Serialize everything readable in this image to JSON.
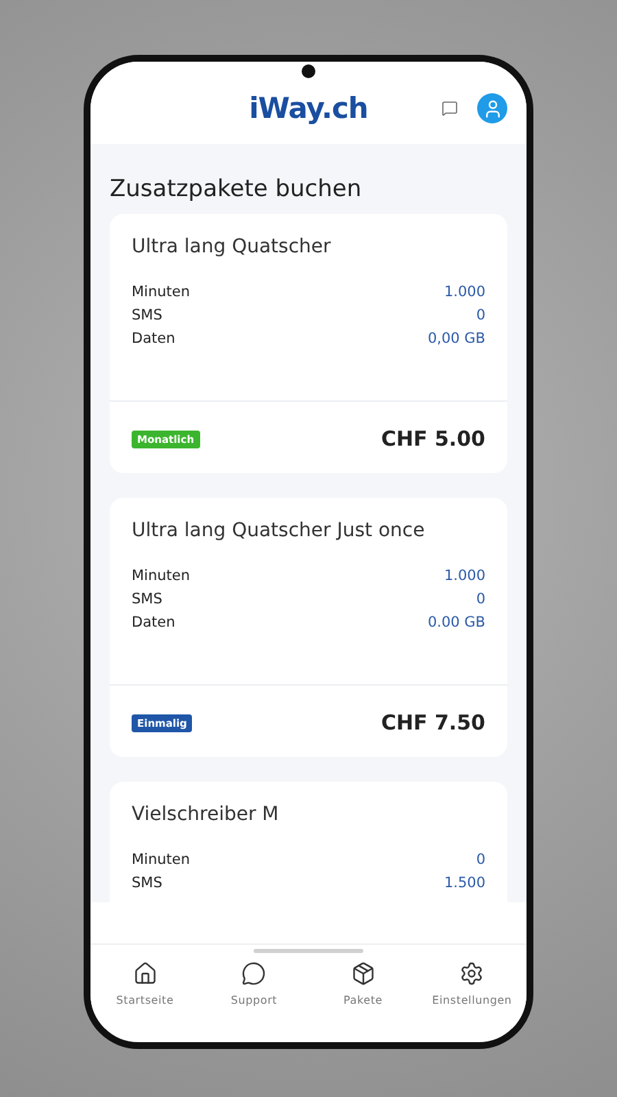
{
  "header": {
    "logo": "iWay.ch"
  },
  "title": "Zusatzpakete buchen",
  "packages": [
    {
      "name": "Ultra lang Quatscher",
      "rows": [
        {
          "label": "Minuten",
          "value": "1.000"
        },
        {
          "label": "SMS",
          "value": "0"
        },
        {
          "label": "Daten",
          "value": "0,00 GB"
        }
      ],
      "badge": {
        "kind": "monthly",
        "label": "Monatlich"
      },
      "price": "CHF 5.00"
    },
    {
      "name": "Ultra lang Quatscher Just once",
      "rows": [
        {
          "label": "Minuten",
          "value": "1.000"
        },
        {
          "label": "SMS",
          "value": "0"
        },
        {
          "label": "Daten",
          "value": "0.00 GB"
        }
      ],
      "badge": {
        "kind": "once",
        "label": "Einmalig"
      },
      "price": "CHF 7.50"
    },
    {
      "name": "Vielschreiber M",
      "rows": [
        {
          "label": "Minuten",
          "value": "0"
        },
        {
          "label": "SMS",
          "value": "1.500"
        }
      ]
    }
  ],
  "nav": [
    {
      "kind": "home",
      "label": "Startseite"
    },
    {
      "kind": "support",
      "label": "Support"
    },
    {
      "kind": "packages",
      "label": "Pakete"
    },
    {
      "kind": "settings",
      "label": "Einstellungen"
    }
  ]
}
